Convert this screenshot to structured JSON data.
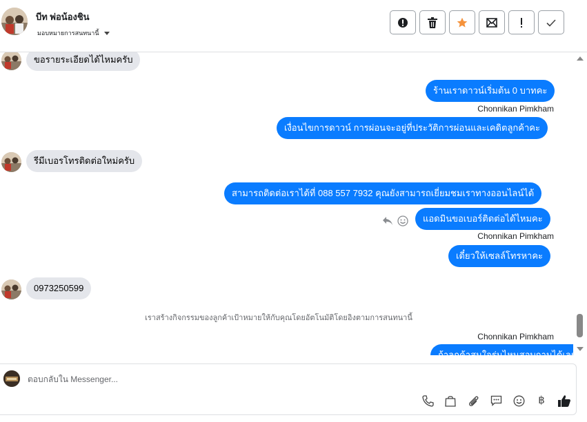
{
  "header": {
    "contact_name": "บีท พ่อน้องชิน",
    "assign_label": "มอบหมายการสนทนานี้"
  },
  "actions": [
    {
      "name": "spam-button",
      "icon": "alert-circle-icon"
    },
    {
      "name": "delete-button",
      "icon": "trash-icon"
    },
    {
      "name": "star-button",
      "icon": "star-icon"
    },
    {
      "name": "mark-unread-button",
      "icon": "envelope-icon"
    },
    {
      "name": "important-button",
      "icon": "exclamation-icon"
    },
    {
      "name": "done-button",
      "icon": "check-icon"
    }
  ],
  "colors": {
    "outgoing_bubble": "#0a7cff",
    "incoming_bubble": "#e4e6eb",
    "star": "#f5923b"
  },
  "messages": {
    "m1_in": "ขอรายระเอียดได้ไหมครับ",
    "m2_out": "ร้านเราดาวน์เริ่มต้น 0 บาทคะ",
    "m2_sender": "Chonnikan Pimkham",
    "m3_out": "เงื่อนไขการดาวน์ การผ่อนจะอยู่ที่ประวัติการผ่อนและเคดิตลูกค้าคะ",
    "m4_in": "รีมีเบอรโทรติดต่อใหม่ครับ",
    "m5_out": "สามารถติดต่อเราได้ที่ 088 557 7932 คุณยังสามารถเยี่ยมชมเราทางออนไลน์ได้",
    "m6_out": "แอดมินขอเบอร์ติดต่อได้ไหมคะ",
    "m6_sender": "Chonnikan Pimkham",
    "m7_out": "เดี๋ยวให้เซลล์โทรหาคะ",
    "m8_in": "0973250599",
    "system_note": "เราสร้างกิจกรรมของลูกค้าเป้าหมายให้กับคุณโดยอัตโนมัติโดยอิงตามการสนทนานี้",
    "m9_sender": "Chonnikan Pimkham",
    "m9_out": "ถ้าลูกค้าสนใจรุ่นไหนสอบถามได้เลยนะคะ"
  },
  "composer": {
    "placeholder": "ตอบกลับใน Messenger...",
    "tools": [
      "phone-icon",
      "shopping-bag-icon",
      "paperclip-icon",
      "saved-replies-icon",
      "emoji-icon",
      "baht-icon",
      "thumbs-up-icon"
    ],
    "baht_symbol": "฿"
  }
}
